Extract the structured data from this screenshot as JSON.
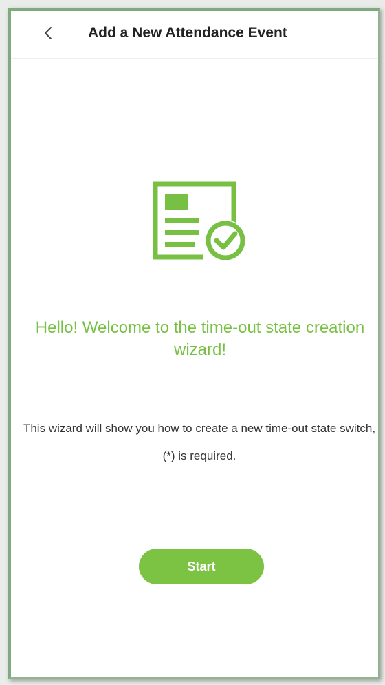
{
  "header": {
    "title": "Add a New Attendance Event",
    "back_icon": "chevron-left-icon"
  },
  "hero": {
    "icon": "document-check-icon",
    "color": "#77c043"
  },
  "welcome_text": "Hello! Welcome to the time-out state creation wizard!",
  "description": "This wizard will show you how to create a new time-out state switch, (*) is required.",
  "start_button": {
    "label": "Start",
    "color": "#7cc243"
  }
}
